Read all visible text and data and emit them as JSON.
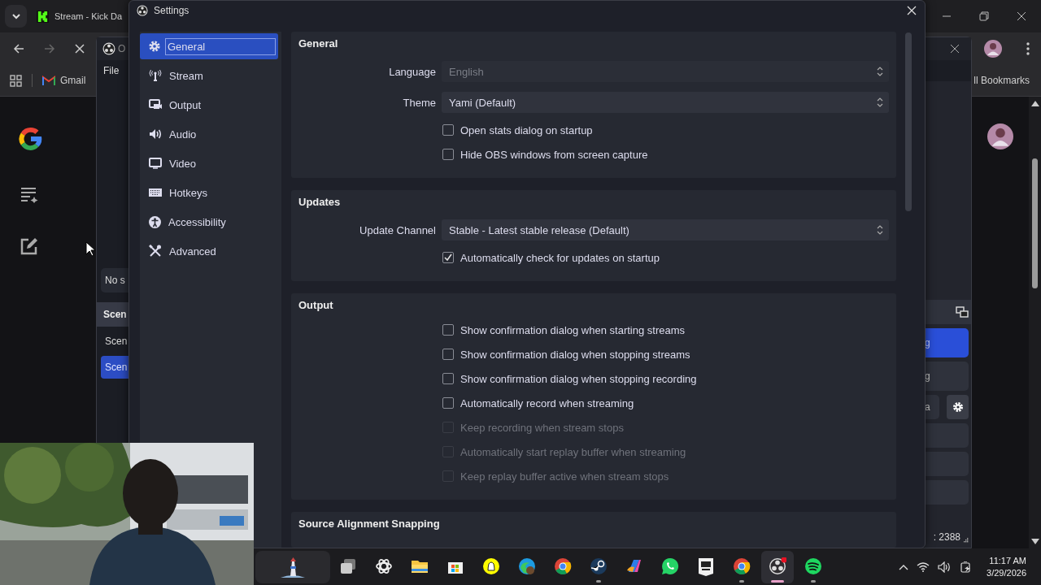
{
  "browser": {
    "tab": {
      "title": "Stream - Kick Da"
    },
    "bookmarks": [
      {
        "label": "Gmail"
      },
      {
        "label": "ll Bookmarks"
      }
    ]
  },
  "obs_window": {
    "title": "O",
    "menu": [
      "File"
    ],
    "scenes": {
      "message": "No s",
      "header": "Scen",
      "items": [
        {
          "label": "Scen",
          "selected": false
        },
        {
          "label": "Scen",
          "selected": true
        }
      ]
    },
    "controls": [
      {
        "label": "g",
        "selected": true
      },
      {
        "label": "g",
        "selected": false
      },
      {
        "label": "a",
        "selected": false
      }
    ],
    "status": ": 2388"
  },
  "settings": {
    "title": "Settings",
    "nav": [
      {
        "label": "General",
        "selected": true
      },
      {
        "label": "Stream",
        "selected": false
      },
      {
        "label": "Output",
        "selected": false
      },
      {
        "label": "Audio",
        "selected": false
      },
      {
        "label": "Video",
        "selected": false
      },
      {
        "label": "Hotkeys",
        "selected": false
      },
      {
        "label": "Accessibility",
        "selected": false
      },
      {
        "label": "Advanced",
        "selected": false
      }
    ],
    "sections": [
      {
        "title": "General",
        "rows": [
          {
            "kind": "select",
            "label": "Language",
            "value": "English",
            "disabled": true
          },
          {
            "kind": "select",
            "label": "Theme",
            "value": "Yami (Default)",
            "disabled": false
          },
          {
            "kind": "checkbox",
            "label": "Open stats dialog on startup",
            "checked": false,
            "disabled": false
          },
          {
            "kind": "checkbox",
            "label": "Hide OBS windows from screen capture",
            "checked": false,
            "disabled": false
          }
        ]
      },
      {
        "title": "Updates",
        "rows": [
          {
            "kind": "select",
            "label": "Update Channel",
            "value": "Stable - Latest stable release (Default)",
            "disabled": false
          },
          {
            "kind": "checkbox",
            "label": "Automatically check for updates on startup",
            "checked": true,
            "disabled": false
          }
        ]
      },
      {
        "title": "Output",
        "rows": [
          {
            "kind": "checkbox",
            "label": "Show confirmation dialog when starting streams",
            "checked": false,
            "disabled": false
          },
          {
            "kind": "checkbox",
            "label": "Show confirmation dialog when stopping streams",
            "checked": false,
            "disabled": false
          },
          {
            "kind": "checkbox",
            "label": "Show confirmation dialog when stopping recording",
            "checked": false,
            "disabled": false
          },
          {
            "kind": "checkbox",
            "label": "Automatically record when streaming",
            "checked": false,
            "disabled": false
          },
          {
            "kind": "checkbox",
            "label": "Keep recording when stream stops",
            "checked": false,
            "disabled": true
          },
          {
            "kind": "checkbox",
            "label": "Automatically start replay buffer when streaming",
            "checked": false,
            "disabled": true
          },
          {
            "kind": "checkbox",
            "label": "Keep replay buffer active when stream stops",
            "checked": false,
            "disabled": true
          }
        ]
      },
      {
        "title": "Source Alignment Snapping"
      }
    ]
  },
  "taskbar": {
    "apps": [
      {
        "running": false,
        "active": false
      },
      {
        "running": false,
        "active": false
      },
      {
        "running": false,
        "active": false
      },
      {
        "running": false,
        "active": false
      },
      {
        "running": false,
        "active": false
      },
      {
        "running": false,
        "active": false
      },
      {
        "running": false,
        "active": false
      },
      {
        "running": true,
        "active": false
      },
      {
        "running": false,
        "active": false
      },
      {
        "running": false,
        "active": false
      },
      {
        "running": false,
        "active": false
      },
      {
        "running": true,
        "active": false
      },
      {
        "running": true,
        "active": true
      },
      {
        "running": true,
        "active": false
      }
    ],
    "time": "11:17 AM",
    "date": "3/29/2026"
  }
}
